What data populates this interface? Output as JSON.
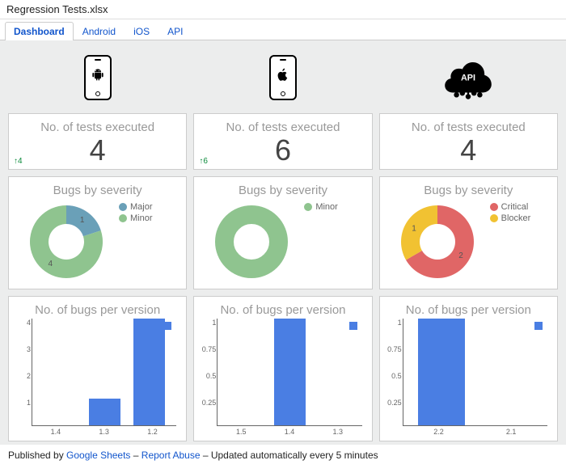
{
  "title": "Regression Tests.xlsx",
  "tabs": [
    "Dashboard",
    "Android",
    "iOS",
    "API"
  ],
  "active_tab": 0,
  "columns": {
    "android": {
      "icon": "android"
    },
    "ios": {
      "icon": "apple"
    },
    "api": {
      "icon": "api"
    }
  },
  "counts": {
    "label": "No. of tests executed",
    "android": {
      "value": "4",
      "delta": "↑4"
    },
    "ios": {
      "value": "6",
      "delta": "↑6"
    },
    "api": {
      "value": "4",
      "delta": ""
    }
  },
  "severity": {
    "title": "Bugs by severity",
    "android": {
      "slices": [
        {
          "name": "Major",
          "value": 1,
          "color": "#6aa0b8"
        },
        {
          "name": "Minor",
          "value": 4,
          "color": "#8fc48f"
        }
      ]
    },
    "ios": {
      "slices": [
        {
          "name": "Minor",
          "value": 1,
          "color": "#8fc48f"
        }
      ]
    },
    "api": {
      "slices": [
        {
          "name": "Critical",
          "value": 2,
          "color": "#e06666"
        },
        {
          "name": "Blocker",
          "value": 1,
          "color": "#f1c232"
        }
      ]
    }
  },
  "chart_data": [
    {
      "type": "bar",
      "title": "No. of bugs per version",
      "platform": "android",
      "categories": [
        "1.4",
        "1.3",
        "1.2"
      ],
      "values": [
        0,
        1,
        4
      ],
      "ylim": [
        0,
        4
      ],
      "yticks": [
        "4",
        "3",
        "2",
        "1"
      ]
    },
    {
      "type": "bar",
      "title": "No. of bugs per version",
      "platform": "ios",
      "categories": [
        "1.5",
        "1.4",
        "1.3"
      ],
      "values": [
        0,
        1,
        0
      ],
      "ylim": [
        0,
        1
      ],
      "yticks": [
        "1",
        "0.75",
        "0.5",
        "0.25"
      ]
    },
    {
      "type": "bar",
      "title": "No. of bugs per version",
      "platform": "api",
      "categories": [
        "2.2",
        "2.1"
      ],
      "values": [
        1,
        0
      ],
      "ylim": [
        0,
        1
      ],
      "yticks": [
        "1",
        "0.75",
        "0.5",
        "0.25"
      ]
    }
  ],
  "footer": {
    "prefix": "Published by ",
    "link1": "Google Sheets",
    "sep1": " – ",
    "link2": "Report Abuse",
    "sep2": " – ",
    "tail": "Updated automatically every 5 minutes"
  }
}
